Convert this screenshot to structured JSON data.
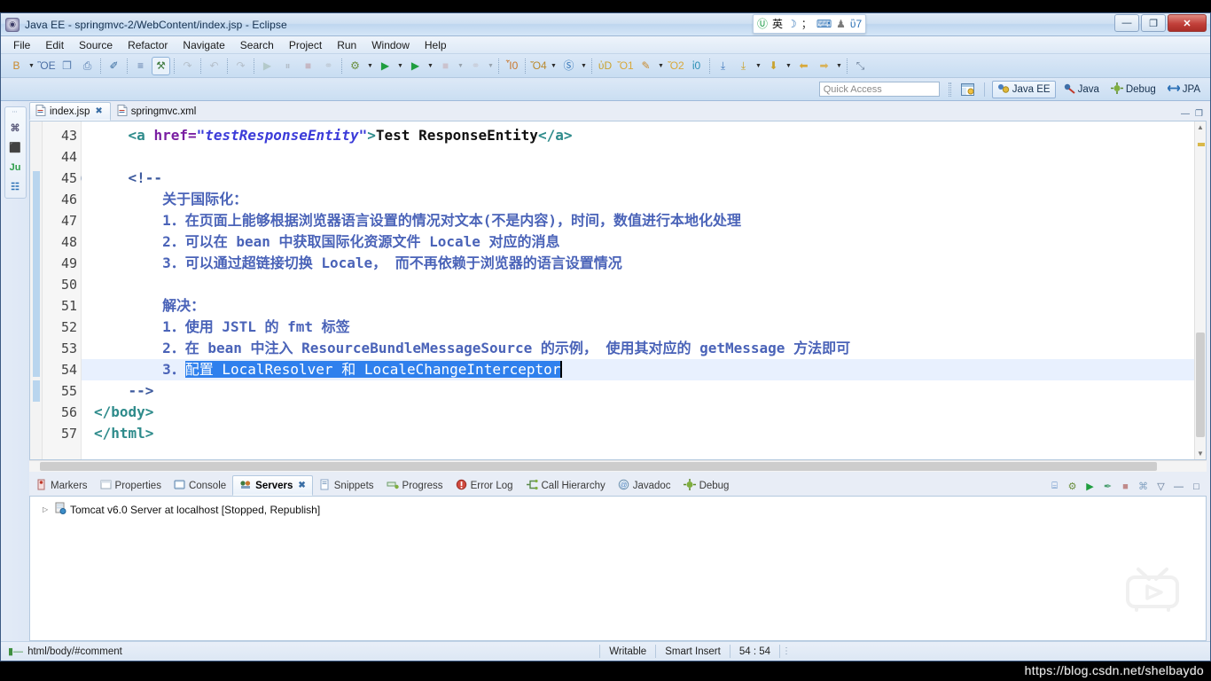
{
  "window": {
    "title": "Java EE - springmvc-2/WebContent/index.jsp - Eclipse",
    "app_icon": "eclipse-icon",
    "minimize_label": "—",
    "maximize_label": "❐",
    "close_label": "✕"
  },
  "ime": {
    "items": [
      {
        "name": "sogou-logo-icon",
        "glyph": "Ⓤ",
        "color": "#1f9e4a"
      },
      {
        "name": "chinese-mode-icon",
        "glyph": "英",
        "color": "#111111"
      },
      {
        "name": "moon-icon",
        "glyph": "☽",
        "color": "#2a6fb5"
      },
      {
        "name": "punctuation-icon",
        "glyph": "；",
        "color": "#333333"
      },
      {
        "name": "soft-keyboard-icon",
        "glyph": "⌨",
        "color": "#2a6fb5"
      },
      {
        "name": "user-icon",
        "glyph": "♟",
        "color": "#7b7b7b"
      },
      {
        "name": "toolbox-icon",
        "glyph": "ὒ7",
        "color": "#2a6fb5"
      }
    ]
  },
  "menubar": {
    "items": [
      "File",
      "Edit",
      "Source",
      "Refactor",
      "Navigate",
      "Search",
      "Project",
      "Run",
      "Window",
      "Help"
    ]
  },
  "toolbar": {
    "groups": [
      {
        "buttons": [
          {
            "name": "new-wizard-button",
            "glyph": "὜B",
            "color": "#c98a2e",
            "arrow": true,
            "dim": false
          },
          {
            "name": "save-button",
            "glyph": "ὋE",
            "color": "#4c6fa5",
            "arrow": false,
            "dim": false
          },
          {
            "name": "save-all-button",
            "glyph": "❐",
            "color": "#5a7fb0",
            "arrow": false,
            "dim": false
          },
          {
            "name": "print-button",
            "glyph": "⎙",
            "color": "#5a7fb0",
            "arrow": false,
            "dim": false
          }
        ]
      },
      {
        "buttons": [
          {
            "name": "toggle-mark-occurrences-button",
            "glyph": "✐",
            "color": "#34689c",
            "arrow": false,
            "dim": false
          }
        ]
      },
      {
        "buttons": [
          {
            "name": "open-task-button",
            "glyph": "≡",
            "color": "#5b7aa8",
            "arrow": false,
            "dim": false
          },
          {
            "name": "validate-button",
            "glyph": "⚒",
            "color": "#3f7a3f",
            "arrow": false,
            "dim": false,
            "pressed": true
          }
        ]
      },
      {
        "buttons": [
          {
            "name": "skip-breakpoints-button",
            "glyph": "↷",
            "color": "#7f7f7f",
            "arrow": false,
            "dim": true
          }
        ]
      },
      {
        "buttons": [
          {
            "name": "undo-button",
            "glyph": "↶",
            "color": "#7f7f7f",
            "arrow": false,
            "dim": true
          }
        ]
      },
      {
        "buttons": [
          {
            "name": "redo-button",
            "glyph": "↷",
            "color": "#7f7f7f",
            "arrow": false,
            "dim": true
          }
        ]
      },
      {
        "buttons": [
          {
            "name": "resume-button",
            "glyph": "▶",
            "color": "#7f9d7f",
            "arrow": false,
            "dim": true
          },
          {
            "name": "suspend-button",
            "glyph": "⏸",
            "color": "#7f7f7f",
            "arrow": false,
            "dim": true
          },
          {
            "name": "terminate-button",
            "glyph": "■",
            "color": "#b06a6a",
            "arrow": false,
            "dim": true
          },
          {
            "name": "disconnect-button",
            "glyph": "⚭",
            "color": "#9a9a9a",
            "arrow": false,
            "dim": true
          }
        ]
      },
      {
        "buttons": [
          {
            "name": "debug-button",
            "glyph": "⚙",
            "color": "#6b8f3f",
            "arrow": true,
            "dim": false
          },
          {
            "name": "run-button",
            "glyph": "▶",
            "color": "#1f9e3f",
            "arrow": true,
            "dim": false
          },
          {
            "name": "run-as-server-button",
            "glyph": "▶",
            "color": "#1f9e3f",
            "arrow": true,
            "dim": false
          },
          {
            "name": "stop-button",
            "glyph": "■",
            "color": "#c08a8a",
            "arrow": true,
            "dim": true
          },
          {
            "name": "profile-button",
            "glyph": "⚭",
            "color": "#b6a0a0",
            "arrow": true,
            "dim": true
          }
        ]
      },
      {
        "buttons": [
          {
            "name": "new-ejb-project-button",
            "glyph": "Ἶ0",
            "color": "#c9772e",
            "arrow": false,
            "dim": false
          }
        ]
      },
      {
        "buttons": [
          {
            "name": "new-java-class-button",
            "glyph": "Ὄ4",
            "color": "#b9892e",
            "arrow": true,
            "dim": false
          },
          {
            "name": "search-button",
            "glyph": "Ⓢ",
            "color": "#2a6fb5",
            "arrow": true,
            "dim": false
          }
        ]
      },
      {
        "buttons": [
          {
            "name": "open-type-button",
            "glyph": "ὐD",
            "color": "#c9a22e",
            "arrow": false,
            "dim": false
          },
          {
            "name": "open-resource-button",
            "glyph": "Ὄ1",
            "color": "#d8a83a",
            "arrow": false,
            "dim": false
          },
          {
            "name": "external-tools-button",
            "glyph": "✎",
            "color": "#c88a2e",
            "arrow": true,
            "dim": false
          },
          {
            "name": "open-perspective-button",
            "glyph": "Ὄ2",
            "color": "#d8a83a",
            "arrow": false,
            "dim": false
          },
          {
            "name": "web-browser-button",
            "glyph": "ἱ0",
            "color": "#2a8fb5",
            "arrow": false,
            "dim": false
          }
        ]
      },
      {
        "buttons": [
          {
            "name": "next-annotation-button",
            "glyph": "⤓",
            "color": "#4a7fbf",
            "arrow": false,
            "dim": false
          },
          {
            "name": "previous-annotation-button",
            "glyph": "⤓",
            "color": "#c9a22e",
            "arrow": true,
            "dim": false
          },
          {
            "name": "last-edit-location-button",
            "glyph": "⬇",
            "color": "#c9a22e",
            "arrow": true,
            "dim": false
          },
          {
            "name": "back-button",
            "glyph": "⬅",
            "color": "#d8a83a",
            "arrow": false,
            "dim": false
          },
          {
            "name": "forward-button",
            "glyph": "➡",
            "color": "#d8b25a",
            "arrow": true,
            "dim": false
          }
        ]
      },
      {
        "buttons": [
          {
            "name": "restore-button",
            "glyph": "⤡",
            "color": "#6b7f99",
            "arrow": false,
            "dim": false
          }
        ]
      }
    ]
  },
  "quick_access": {
    "placeholder": "Quick Access",
    "value": ""
  },
  "perspectives": {
    "open_perspective_icon": "open-perspective-icon",
    "items": [
      {
        "name": "perspective-java-ee",
        "label": "Java EE",
        "icon": "java-ee-icon",
        "active": true
      },
      {
        "name": "perspective-java",
        "label": "Java",
        "icon": "java-icon",
        "active": false
      },
      {
        "name": "perspective-debug",
        "label": "Debug",
        "icon": "debug-icon",
        "active": false
      },
      {
        "name": "perspective-jpa",
        "label": "JPA",
        "icon": "jpa-icon",
        "active": false
      }
    ]
  },
  "min_stack": {
    "restore_label": "⋯",
    "icons": [
      {
        "name": "project-explorer-icon",
        "glyph": "⌘",
        "color": "#5a5a7a"
      },
      {
        "name": "servers-view-icon",
        "glyph": "⬛",
        "color": "#c98a2e"
      },
      {
        "name": "junit-view-icon",
        "glyph": "Ju",
        "color": "#2e9e4a"
      },
      {
        "name": "outline-view-icon",
        "glyph": "☷",
        "color": "#2a6fb5"
      }
    ]
  },
  "editor": {
    "tabs": [
      {
        "name": "editor-tab-index-jsp",
        "label": "index.jsp",
        "icon": "jsp-file-icon",
        "active": true,
        "closable": true
      },
      {
        "name": "editor-tab-springmvc-xml",
        "label": "springmvc.xml",
        "icon": "xml-file-icon",
        "active": false,
        "closable": false
      }
    ],
    "minimize_label": "—",
    "maximize_label": "❐",
    "first_visible_line": 42,
    "lines": [
      {
        "num": 43,
        "folded": false,
        "selected": false,
        "tokens": [
          {
            "t": "    ",
            "c": "txt"
          },
          {
            "t": "<a ",
            "c": "tag"
          },
          {
            "t": "href=",
            "c": "attr"
          },
          {
            "t": "\"testResponseEntity\"",
            "c": "str"
          },
          {
            "t": ">",
            "c": "tag"
          },
          {
            "t": "Test ResponseEntity",
            "c": "txt"
          },
          {
            "t": "</a>",
            "c": "tag"
          }
        ]
      },
      {
        "num": 44,
        "folded": false,
        "selected": false,
        "tokens": []
      },
      {
        "num": 45,
        "folded": true,
        "selected": false,
        "tokens": [
          {
            "t": "    <!--",
            "c": "cmt"
          }
        ]
      },
      {
        "num": 46,
        "folded": false,
        "selected": false,
        "tokens": [
          {
            "t": "        关于国际化：",
            "c": "cmt-cn"
          }
        ]
      },
      {
        "num": 47,
        "folded": false,
        "selected": false,
        "tokens": [
          {
            "t": "        1．在页面上能够根据浏览器语言设置的情况对文本(不是内容)，时间，数值进行本地化处理",
            "c": "cmt-cn"
          }
        ]
      },
      {
        "num": 48,
        "folded": false,
        "selected": false,
        "tokens": [
          {
            "t": "        2．可以在 bean 中获取国际化资源文件 Locale 对应的消息",
            "c": "cmt-cn"
          }
        ]
      },
      {
        "num": 49,
        "folded": false,
        "selected": false,
        "tokens": [
          {
            "t": "        3．可以通过超链接切换 Locale， 而不再依赖于浏览器的语言设置情况",
            "c": "cmt-cn"
          }
        ]
      },
      {
        "num": 50,
        "folded": false,
        "selected": false,
        "tokens": []
      },
      {
        "num": 51,
        "folded": false,
        "selected": false,
        "tokens": [
          {
            "t": "        解决：",
            "c": "cmt-cn"
          }
        ]
      },
      {
        "num": 52,
        "folded": false,
        "selected": false,
        "tokens": [
          {
            "t": "        1．使用 JSTL 的 fmt 标签",
            "c": "cmt-cn"
          }
        ]
      },
      {
        "num": 53,
        "folded": false,
        "selected": false,
        "tokens": [
          {
            "t": "        2．在 bean 中注入 ResourceBundleMessageSource 的示例， 使用其对应的 getMessage 方法即可",
            "c": "cmt-cn"
          }
        ]
      },
      {
        "num": 54,
        "folded": false,
        "selected": true,
        "tokens": [
          {
            "t": "        3．",
            "c": "cmt-cn"
          },
          {
            "t": "配置 LocalResolver 和 LocaleChangeInterceptor",
            "c": "hl"
          },
          {
            "t": "",
            "c": "caret"
          }
        ]
      },
      {
        "num": 55,
        "folded": false,
        "selected": false,
        "tokens": [
          {
            "t": "    -->",
            "c": "cmt"
          }
        ]
      },
      {
        "num": 56,
        "folded": false,
        "selected": false,
        "tokens": [
          {
            "t": "</body>",
            "c": "tag"
          }
        ]
      },
      {
        "num": 57,
        "folded": false,
        "selected": false,
        "tokens": [
          {
            "t": "</html>",
            "c": "tag"
          }
        ]
      }
    ]
  },
  "bottom_view": {
    "tabs": [
      {
        "name": "tab-markers",
        "label": "Markers",
        "icon": "markers-icon",
        "active": false
      },
      {
        "name": "tab-properties",
        "label": "Properties",
        "icon": "properties-icon",
        "active": false
      },
      {
        "name": "tab-console",
        "label": "Console",
        "icon": "console-icon",
        "active": false
      },
      {
        "name": "tab-servers",
        "label": "Servers",
        "icon": "servers-icon",
        "active": true
      },
      {
        "name": "tab-snippets",
        "label": "Snippets",
        "icon": "snippets-icon",
        "active": false
      },
      {
        "name": "tab-progress",
        "label": "Progress",
        "icon": "progress-icon",
        "active": false
      },
      {
        "name": "tab-error-log",
        "label": "Error Log",
        "icon": "error-log-icon",
        "active": false
      },
      {
        "name": "tab-call-hierarchy",
        "label": "Call Hierarchy",
        "icon": "call-hierarchy-icon",
        "active": false
      },
      {
        "name": "tab-javadoc",
        "label": "Javadoc",
        "icon": "javadoc-icon",
        "active": false
      },
      {
        "name": "tab-debug",
        "label": "Debug",
        "icon": "debug-view-icon",
        "active": false
      }
    ],
    "toolbar": [
      {
        "name": "new-server-button",
        "glyph": "⌸",
        "color": "#4a7fbf"
      },
      {
        "name": "debug-server-button",
        "glyph": "⚙",
        "color": "#6b8f3f"
      },
      {
        "name": "start-server-button",
        "glyph": "▶",
        "color": "#1f9e3f"
      },
      {
        "name": "profile-server-button",
        "glyph": "✒",
        "color": "#4a9e6f"
      },
      {
        "name": "stop-server-button",
        "glyph": "■",
        "color": "#c08a8a"
      },
      {
        "name": "publish-server-button",
        "glyph": "⌘",
        "color": "#7f9fbf"
      },
      {
        "name": "view-menu-button",
        "glyph": "▽",
        "color": "#5a7291"
      },
      {
        "name": "minimize-view-button",
        "glyph": "—",
        "color": "#5a7291"
      },
      {
        "name": "maximize-view-button",
        "glyph": "□",
        "color": "#5a7291"
      }
    ],
    "server": {
      "twisty": "▷",
      "icon": "tomcat-server-icon",
      "label": "Tomcat v6.0 Server at localhost  [Stopped, Republish]"
    }
  },
  "statusbar": {
    "breadcrumb_icon": "comment-node-icon",
    "breadcrumb": "html/body/#comment",
    "writable": "Writable",
    "insert_mode": "Smart Insert",
    "position": "54 : 54",
    "more_dots": "⋮"
  },
  "watermark": {
    "url": "https://blog.csdn.net/shelbaydo",
    "logo_name": "tv-play-watermark-icon"
  }
}
